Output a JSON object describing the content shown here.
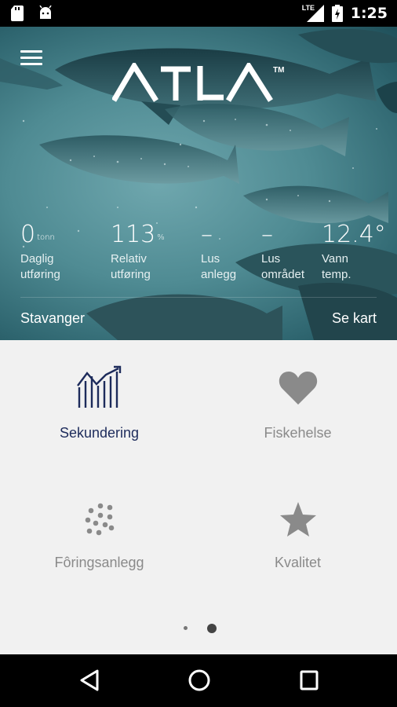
{
  "status_bar": {
    "time": "1:25",
    "network": "LTE"
  },
  "app": {
    "logo_text": "ATLA",
    "trademark": "TM"
  },
  "stats": [
    {
      "value": "0",
      "unit": "tonn",
      "label_line1": "Daglig",
      "label_line2": "utføring"
    },
    {
      "value": "113",
      "unit": "%",
      "label_line1": "Relativ",
      "label_line2": "utføring"
    },
    {
      "value": "–",
      "unit": "",
      "label_line1": "Lus",
      "label_line2": "anlegg"
    },
    {
      "value": "–",
      "unit": "",
      "label_line1": "Lus",
      "label_line2": "området"
    },
    {
      "value": "12.4°",
      "unit": "",
      "label_line1": "Vann",
      "label_line2": "temp."
    }
  ],
  "location": "Stavanger",
  "map_link": "Se kart",
  "tiles": [
    {
      "label": "Sekundering",
      "icon": "chart-trend-icon",
      "active": true
    },
    {
      "label": "Fiskehelse",
      "icon": "heart-icon",
      "active": false
    },
    {
      "label": "Fôringsanlegg",
      "icon": "pellets-icon",
      "active": false
    },
    {
      "label": "Kvalitet",
      "icon": "star-icon",
      "active": false
    }
  ],
  "pager": {
    "page_count": 2,
    "current_page": 2
  },
  "colors": {
    "active": "#1d2b5b",
    "inactive": "#8a8a8a",
    "hero": "#4f8b93",
    "background": "#f1f1f1"
  }
}
